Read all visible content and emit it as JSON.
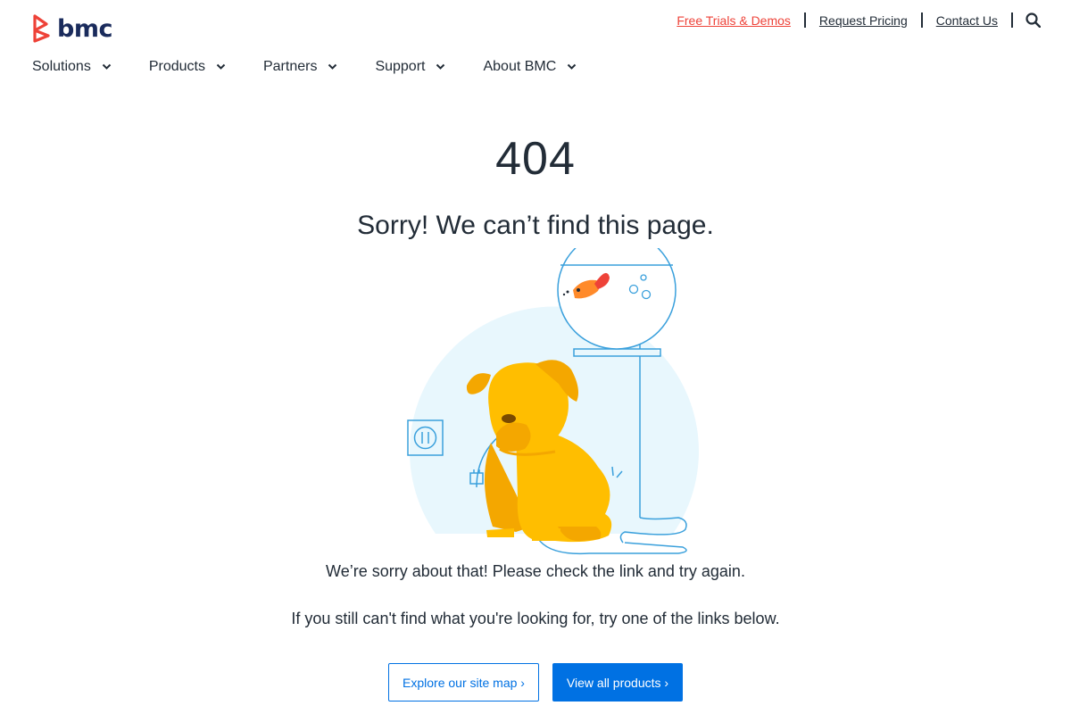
{
  "header": {
    "logo_text": "bmc",
    "utility_links": [
      "Free Trials & Demos",
      "Request Pricing",
      "Contact Us"
    ],
    "search_icon": "search-icon"
  },
  "nav": {
    "items": [
      "Solutions",
      "Products",
      "Partners",
      "Support",
      "About BMC"
    ],
    "dropdown_icon": "chevron-down-icon"
  },
  "error": {
    "code": "404",
    "title": "Sorry! We can’t find this page.",
    "message_1": "We’re sorry about that! Please check the link and try again.",
    "message_2": "If you still can't find what you're looking for, try one of the links below."
  },
  "buttons": {
    "site_map": "Explore our site map ›",
    "products": "View all products ›"
  },
  "colors": {
    "brand_orange": "#ee4238",
    "brand_navy": "#1a2b5c",
    "button_blue": "#0071e3",
    "dog_yellow": "#ffbe00",
    "illustration_bg": "#e8f7fd"
  }
}
